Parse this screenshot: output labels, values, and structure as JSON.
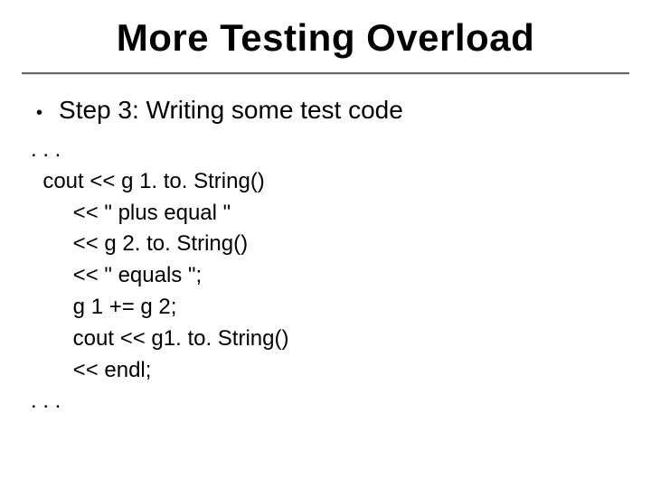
{
  "title": "More Testing Overload",
  "bullet": {
    "text": "Step 3:  Writing some test code"
  },
  "code": ". . .\n  cout << g 1. to. String()\n       << \" plus equal \"\n       << g 2. to. String()\n       << \" equals \";\n       g 1 += g 2;\n       cout << g1. to. String()\n       << endl;\n. . ."
}
